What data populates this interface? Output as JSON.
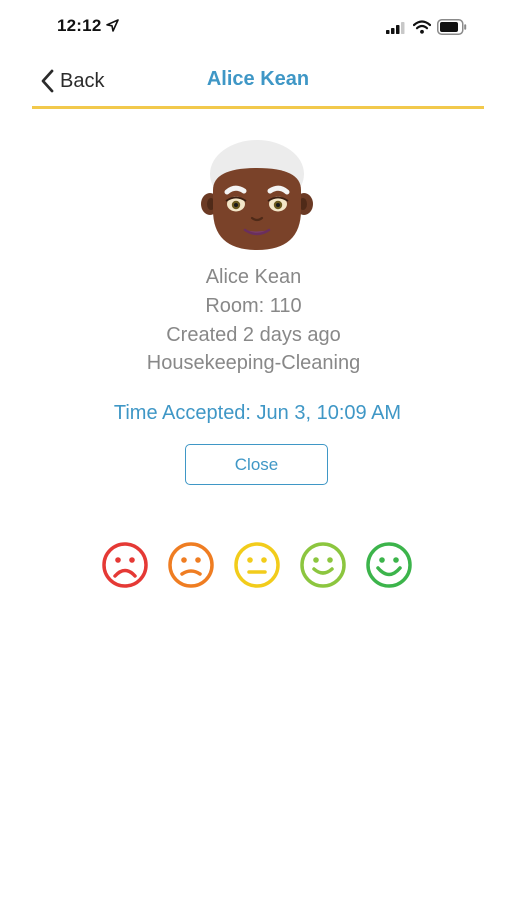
{
  "status_bar": {
    "time": "12:12"
  },
  "nav": {
    "back_label": "Back",
    "title": "Alice Kean"
  },
  "profile": {
    "name": "Alice Kean",
    "room": "Room: 110",
    "created": "Created 2 days ago",
    "category": "Housekeeping-Cleaning",
    "time_accepted": "Time Accepted: Jun 3, 10:09 AM"
  },
  "actions": {
    "close_label": "Close"
  },
  "rating": {
    "faces": [
      {
        "name": "very-sad-face-icon",
        "color": "#e53935"
      },
      {
        "name": "sad-face-icon",
        "color": "#ef7d22"
      },
      {
        "name": "neutral-face-icon",
        "color": "#f2cc1b"
      },
      {
        "name": "happy-face-icon",
        "color": "#8cc63f"
      },
      {
        "name": "very-happy-face-icon",
        "color": "#3cb44b"
      }
    ]
  },
  "colors": {
    "accent": "#3f97c6",
    "divider": "#f2c94c",
    "muted_text": "#888888"
  }
}
